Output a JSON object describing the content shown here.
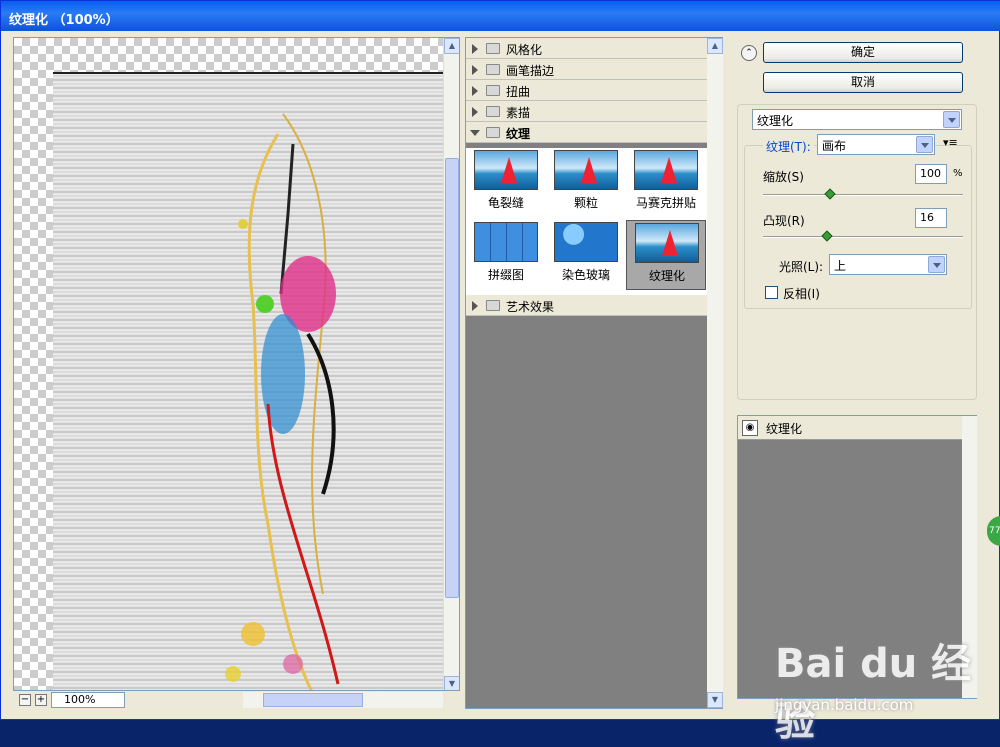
{
  "window": {
    "title": "纹理化 （100%）"
  },
  "preview": {
    "zoom": "100%"
  },
  "filters": {
    "categories": [
      {
        "label": "风格化",
        "open": false
      },
      {
        "label": "画笔描边",
        "open": false
      },
      {
        "label": "扭曲",
        "open": false
      },
      {
        "label": "素描",
        "open": false
      },
      {
        "label": "纹理",
        "open": true
      },
      {
        "label": "艺术效果",
        "open": false
      }
    ],
    "texture_items": [
      "龟裂缝",
      "颗粒",
      "马赛克拼贴",
      "拼缀图",
      "染色玻璃",
      "纹理化"
    ],
    "selected": "纹理化"
  },
  "buttons": {
    "ok": "确定",
    "cancel": "取消"
  },
  "settings": {
    "filter_select": "纹理化",
    "texture_label": "纹理(T):",
    "texture_value": "画布",
    "scale_label": "缩放(S)",
    "scale_value": "100",
    "scale_unit": "%",
    "relief_label": "凸现(R)",
    "relief_value": "16",
    "light_label": "光照(L):",
    "light_value": "上",
    "invert_label": "反相(I)",
    "invert_checked": false
  },
  "layers": {
    "row_label": "纹理化"
  },
  "watermark": {
    "brand": "Bai du 经验",
    "url": "jingyan.baidu.com"
  },
  "colors": {
    "title_bar": "#0a5ef0",
    "dialog_bg": "#ece9d8",
    "slider_knob": "#3a9b3a"
  }
}
